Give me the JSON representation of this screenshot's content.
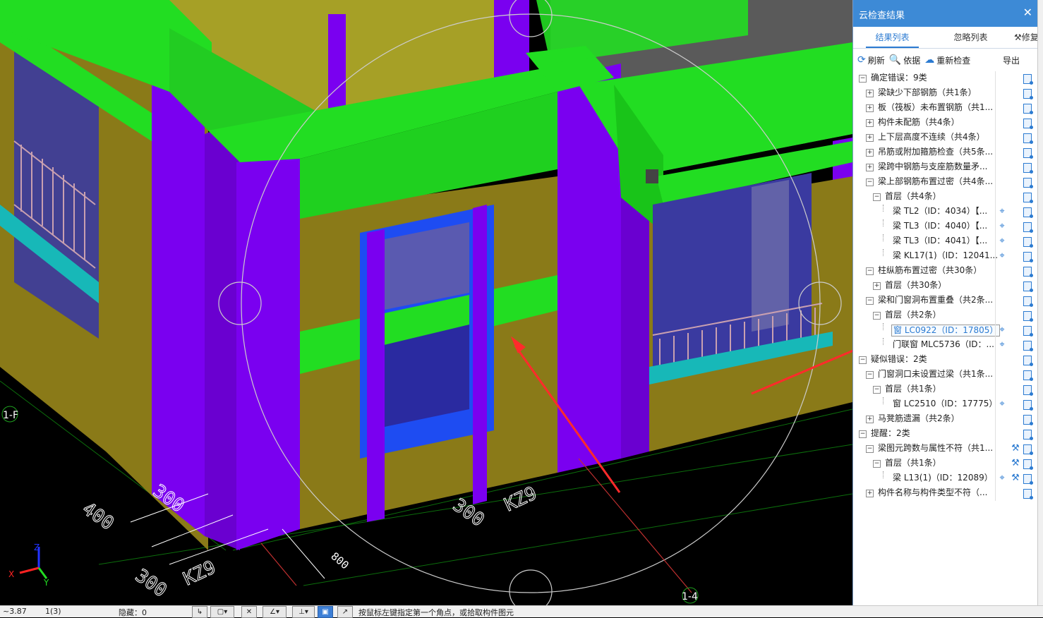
{
  "viewport": {
    "dimension_labels": [
      "300",
      "400",
      "300",
      "KZ9",
      "300",
      "KZ9",
      "800"
    ],
    "axis_labels": {
      "left": "1-F",
      "bottom": "1-4"
    },
    "coord_axes": {
      "z": "Z",
      "x": "X",
      "y": "Y"
    },
    "colors": {
      "column": "#7a00f0",
      "beam": "#22dd22",
      "wall": "#8a7a18",
      "slab": "#a6a026",
      "roof": "#5a5a5a",
      "window_frame": "#1e4cf2",
      "glass": "#2233aa",
      "railing": "#c9a0b0",
      "arrow": "#ff2b2b"
    }
  },
  "panel": {
    "title": "云检查结果",
    "close_icon": "close-icon",
    "tabs": [
      "结果列表",
      "忽略列表",
      "修复"
    ],
    "toolbar": {
      "refresh": "刷新",
      "basis": "依据",
      "recheck": "重新检查",
      "export": "导出"
    },
    "tree": [
      {
        "level": 0,
        "exp": "-",
        "label": "确定错误：9类",
        "loc": false,
        "fix": false
      },
      {
        "level": 1,
        "exp": "+",
        "label": "梁缺少下部钢筋（共1条）",
        "loc": false,
        "fix": false
      },
      {
        "level": 1,
        "exp": "+",
        "label": "板（筏板）未布置钢筋（共1...",
        "loc": false,
        "fix": false
      },
      {
        "level": 1,
        "exp": "+",
        "label": "构件未配筋（共4条）",
        "loc": false,
        "fix": false
      },
      {
        "level": 1,
        "exp": "+",
        "label": "上下层高度不连续（共4条）",
        "loc": false,
        "fix": false
      },
      {
        "level": 1,
        "exp": "+",
        "label": "吊筋或附加箍筋检查（共5条...",
        "loc": false,
        "fix": false
      },
      {
        "level": 1,
        "exp": "+",
        "label": "梁跨中钢筋与支座筋数量矛...",
        "loc": false,
        "fix": false
      },
      {
        "level": 1,
        "exp": "-",
        "label": "梁上部钢筋布置过密（共4条...",
        "loc": false,
        "fix": false
      },
      {
        "level": 2,
        "exp": "-",
        "label": "首层（共4条）",
        "loc": false,
        "fix": false
      },
      {
        "level": 3,
        "exp": "",
        "label": "梁 TL2（ID：4034）【...",
        "loc": true,
        "fix": false
      },
      {
        "level": 3,
        "exp": "",
        "label": "梁 TL3（ID：4040）【...",
        "loc": true,
        "fix": false
      },
      {
        "level": 3,
        "exp": "",
        "label": "梁 TL3（ID：4041）【...",
        "loc": true,
        "fix": false
      },
      {
        "level": 3,
        "exp": "",
        "label": "梁 KL17(1)（ID：12041...",
        "loc": true,
        "fix": false
      },
      {
        "level": 1,
        "exp": "-",
        "label": "柱纵筋布置过密（共30条）",
        "loc": false,
        "fix": false
      },
      {
        "level": 2,
        "exp": "+",
        "label": "首层（共30条）",
        "loc": false,
        "fix": false
      },
      {
        "level": 1,
        "exp": "-",
        "label": "梁和门窗洞布置重叠（共2条...",
        "loc": false,
        "fix": false
      },
      {
        "level": 2,
        "exp": "-",
        "label": "首层（共2条）",
        "loc": false,
        "fix": false
      },
      {
        "level": 3,
        "exp": "",
        "label": "窗 LC0922（ID：17805）",
        "loc": true,
        "fix": false,
        "selected": true
      },
      {
        "level": 3,
        "exp": "",
        "label": "门联窗 MLC5736（ID：...",
        "loc": true,
        "fix": false
      },
      {
        "level": 0,
        "exp": "-",
        "label": "疑似错误：2类",
        "loc": false,
        "fix": false
      },
      {
        "level": 1,
        "exp": "-",
        "label": "门窗洞口未设置过梁（共1条...",
        "loc": false,
        "fix": false
      },
      {
        "level": 2,
        "exp": "-",
        "label": "首层（共1条）",
        "loc": false,
        "fix": false
      },
      {
        "level": 3,
        "exp": "",
        "label": "窗 LC2510（ID：17775）",
        "loc": true,
        "fix": false
      },
      {
        "level": 1,
        "exp": "+",
        "label": "马凳筋遗漏（共2条）",
        "loc": false,
        "fix": false
      },
      {
        "level": 0,
        "exp": "-",
        "label": "提醒：2类",
        "loc": false,
        "fix": false
      },
      {
        "level": 1,
        "exp": "-",
        "label": "梁图元跨数与属性不符（共1...",
        "loc": false,
        "fix": true
      },
      {
        "level": 2,
        "exp": "-",
        "label": "首层（共1条）",
        "loc": false,
        "fix": true
      },
      {
        "level": 3,
        "exp": "",
        "label": "梁 L13(1)（ID：12089）",
        "loc": true,
        "fix": true
      },
      {
        "level": 1,
        "exp": "+",
        "label": "构件名称与构件类型不符（...",
        "loc": false,
        "fix": false
      }
    ]
  },
  "statusbar": {
    "coord": "~3.87",
    "page": "1(3)",
    "hidden": "隐藏：0",
    "hint": "按鼠标左键指定第一个角点，或拾取构件图元"
  }
}
